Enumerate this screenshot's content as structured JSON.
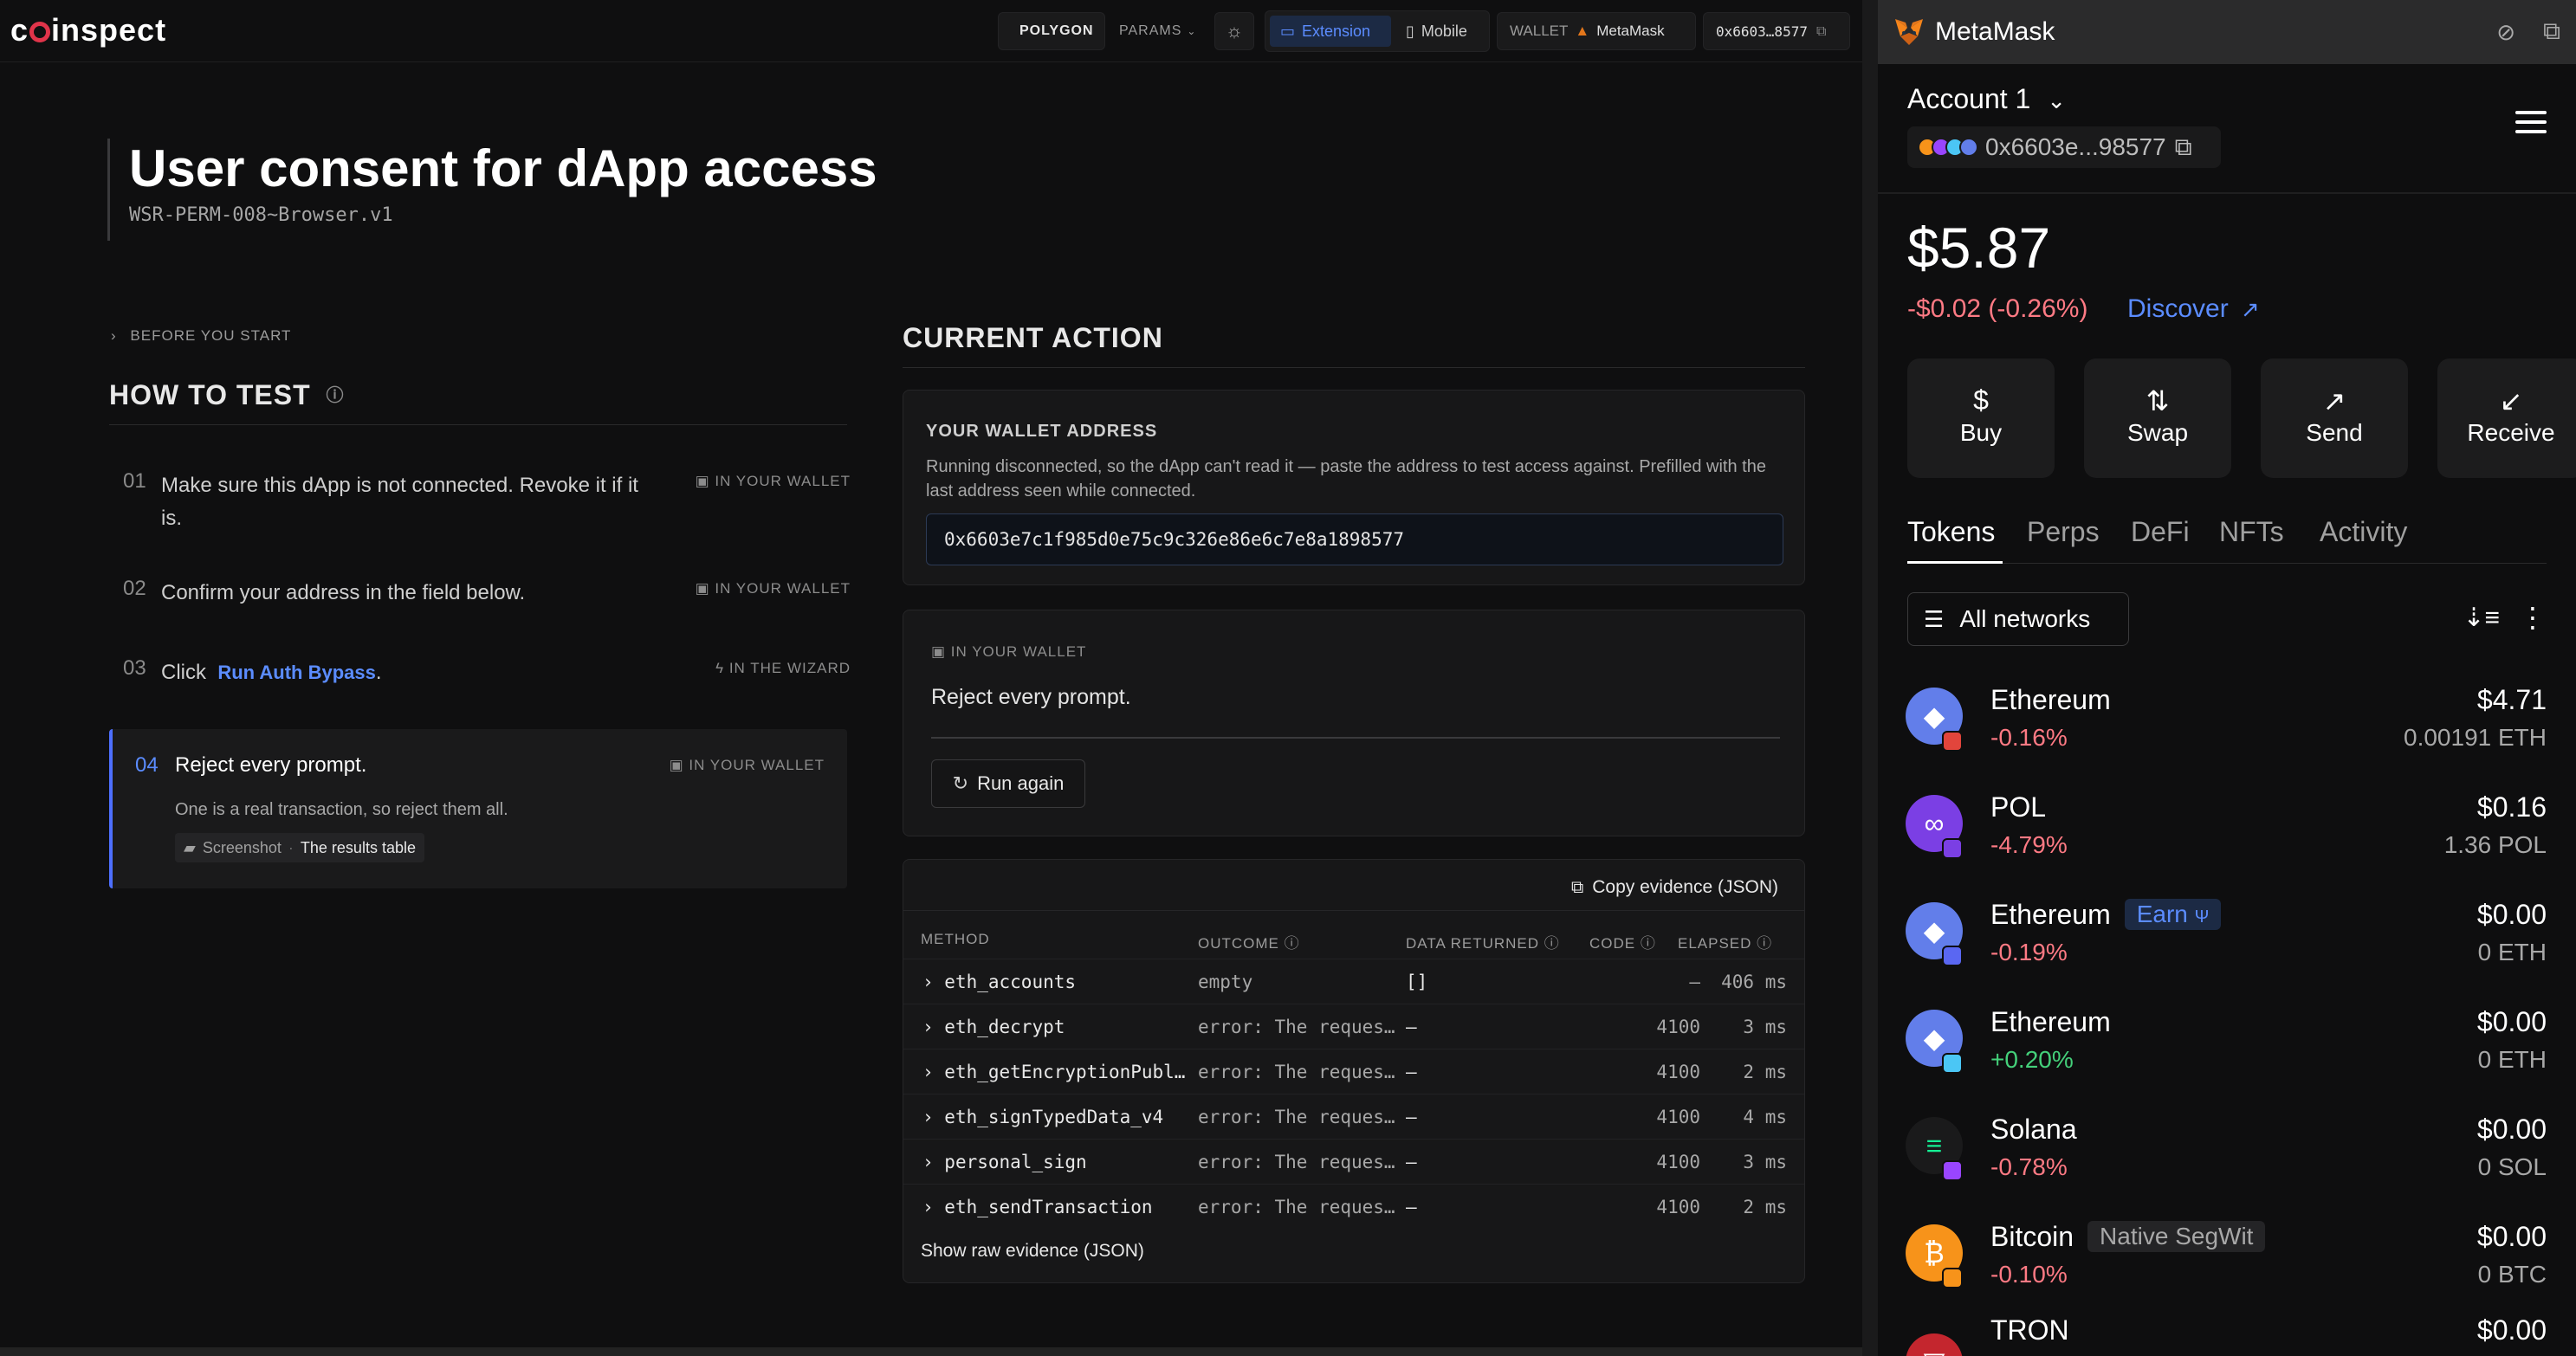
{
  "app": {
    "logo": "coinspect",
    "network": "POLYGON",
    "params_label": "PARAMS",
    "view_extension": "Extension",
    "view_mobile": "Mobile",
    "wallet_label": "WALLET",
    "wallet_name": "MetaMask",
    "address_short": "0x6603…8577"
  },
  "page": {
    "title": "User consent for dApp access",
    "subtitle": "WSR-PERM-008~Browser.v1",
    "before_you_start": "BEFORE YOU START",
    "how_to_test": "HOW TO TEST",
    "steps": [
      {
        "num": "01",
        "text": "Make sure this dApp is not connected. Revoke it if it is.",
        "tag": "IN YOUR WALLET"
      },
      {
        "num": "02",
        "text": "Confirm your address in the field below.",
        "tag": "IN YOUR WALLET"
      },
      {
        "num": "03",
        "text": "Click",
        "link": "Run Auth Bypass",
        "tag": "IN THE WIZARD"
      },
      {
        "num": "04",
        "text": "Reject every prompt.",
        "tag": "IN YOUR WALLET",
        "desc": "One is a real transaction, so reject them all.",
        "pill1": "Screenshot",
        "pill2": "The results table"
      }
    ]
  },
  "current": {
    "title": "CURRENT ACTION",
    "addr_label": "YOUR WALLET ADDRESS",
    "addr_desc": "Running disconnected, so the dApp can't read it — paste the address to test access against. Prefilled with the last address seen while connected.",
    "addr_value": "0x6603e7c1f985d0e75c9c326e86e6c7e8a1898577",
    "prompt_tag": "IN YOUR WALLET",
    "prompt_text": "Reject every prompt.",
    "run_again": "Run again",
    "copy_evidence": "Copy evidence (JSON)",
    "show_raw": "Show raw evidence (JSON)",
    "columns": {
      "method": "METHOD",
      "outcome": "OUTCOME",
      "data": "DATA RETURNED",
      "code": "CODE",
      "elapsed": "ELAPSED"
    },
    "rows": [
      {
        "method": "eth_accounts",
        "outcome": "empty",
        "data": "[]",
        "code": "—",
        "elapsed": "406 ms"
      },
      {
        "method": "eth_decrypt",
        "outcome": "error: The reques…",
        "data": "—",
        "code": "4100",
        "elapsed": "3 ms"
      },
      {
        "method": "eth_getEncryptionPubl…",
        "outcome": "error: The reques…",
        "data": "—",
        "code": "4100",
        "elapsed": "2 ms"
      },
      {
        "method": "eth_signTypedData_v4",
        "outcome": "error: The reques…",
        "data": "—",
        "code": "4100",
        "elapsed": "4 ms"
      },
      {
        "method": "personal_sign",
        "outcome": "error: The reques…",
        "data": "—",
        "code": "4100",
        "elapsed": "3 ms"
      },
      {
        "method": "eth_sendTransaction",
        "outcome": "error: The reques…",
        "data": "—",
        "code": "4100",
        "elapsed": "2 ms"
      }
    ]
  },
  "metamask": {
    "title": "MetaMask",
    "account": "Account 1",
    "address": "0x6603e...98577",
    "balance": "$5.87",
    "change": "-$0.02 (-0.26%)",
    "discover": "Discover",
    "actions": [
      "Buy",
      "Swap",
      "Send",
      "Receive"
    ],
    "tabs": [
      "Tokens",
      "Perps",
      "DeFi",
      "NFTs",
      "Activity"
    ],
    "filter": "All networks",
    "tokens": [
      {
        "name": "Ethereum",
        "change": "-0.16%",
        "usd": "$4.71",
        "amount": "0.00191 ETH",
        "color": "#627eea",
        "badge": "#e2453c",
        "neg": true
      },
      {
        "name": "POL",
        "change": "-4.79%",
        "usd": "$0.16",
        "amount": "1.36 POL",
        "color": "#7b3fe4",
        "badge": "#7b3fe4",
        "neg": true
      },
      {
        "name": "Ethereum",
        "change": "-0.19%",
        "usd": "$0.00",
        "amount": "0 ETH",
        "color": "#627eea",
        "badge": "#5a67f2",
        "neg": true,
        "extra": "Earn"
      },
      {
        "name": "Ethereum",
        "change": "+0.20%",
        "usd": "$0.00",
        "amount": "0 ETH",
        "color": "#627eea",
        "badge": "#4bc6f5",
        "neg": false
      },
      {
        "name": "Solana",
        "change": "-0.78%",
        "usd": "$0.00",
        "amount": "0 SOL",
        "color": "#111",
        "badge": "#9945ff",
        "neg": true
      },
      {
        "name": "Bitcoin",
        "change": "-0.10%",
        "usd": "$0.00",
        "amount": "0 BTC",
        "color": "#f7931a",
        "badge": "#f7931a",
        "neg": true,
        "extra": "Native SegWit"
      },
      {
        "name": "TRON",
        "change": "",
        "usd": "$0.00",
        "amount": "",
        "color": "#c4262e",
        "badge": "#c4262e",
        "neg": true
      }
    ]
  }
}
